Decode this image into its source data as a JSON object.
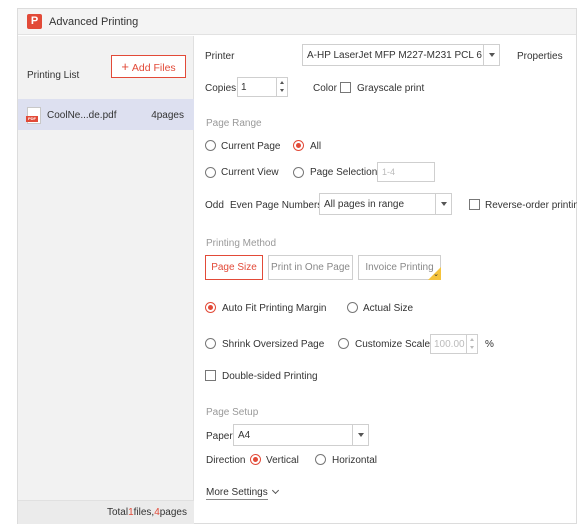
{
  "window": {
    "title": "Advanced Printing",
    "logo_glyph": "P",
    "accent": "#e24a38"
  },
  "left": {
    "printing_list_label": "Printing List",
    "add_files_label": "Add Files",
    "add_files_icon": "+",
    "files": [
      {
        "name": "CoolNe...de.pdf",
        "pages": "4pages",
        "icon": "pdf-icon"
      }
    ],
    "footer": {
      "total_prefix": "Total",
      "file_count": "1",
      "files_word": "files,",
      "page_count": "4",
      "pages_word": "pages"
    }
  },
  "printer": {
    "label": "Printer",
    "value": "A-HP LaserJet MFP M227-M231 PCL 6",
    "properties_label": "Properties"
  },
  "copies": {
    "label": "Copies",
    "value": "1"
  },
  "color": {
    "label": "Color",
    "grayscale_label": "Grayscale print",
    "grayscale_checked": false
  },
  "page_range": {
    "section_label": "Page Range",
    "current_page_label": "Current Page",
    "all_label": "All",
    "current_view_label": "Current View",
    "page_selection_label": "Page Selection",
    "page_selection_placeholder": "1-4",
    "selected": "All"
  },
  "odd_even": {
    "label_odd": "Odd",
    "label_rest": "Even Page Numbers",
    "value": "All pages in range",
    "reverse_label": "Reverse-order printing"
  },
  "printing_method": {
    "section_label": "Printing Method",
    "buttons": [
      "Page Size",
      "Print in One Page",
      "Invoice Printing"
    ],
    "active": "Page Size"
  },
  "scaling": {
    "auto_fit_label": "Auto Fit Printing Margin",
    "actual_size_label": "Actual Size",
    "shrink_label": "Shrink Oversized Page",
    "customize_label": "Customize Scale",
    "scale_value": "100.00",
    "percent": "%",
    "selected": "Auto Fit Printing Margin"
  },
  "duplex": {
    "label": "Double-sided Printing",
    "checked": false
  },
  "page_setup": {
    "section_label": "Page Setup",
    "paper_label": "Paper",
    "paper_value": "A4",
    "direction_label": "Direction",
    "vertical_label": "Vertical",
    "horizontal_label": "Horizontal",
    "selected": "Vertical"
  },
  "more_settings_label": "More Settings"
}
